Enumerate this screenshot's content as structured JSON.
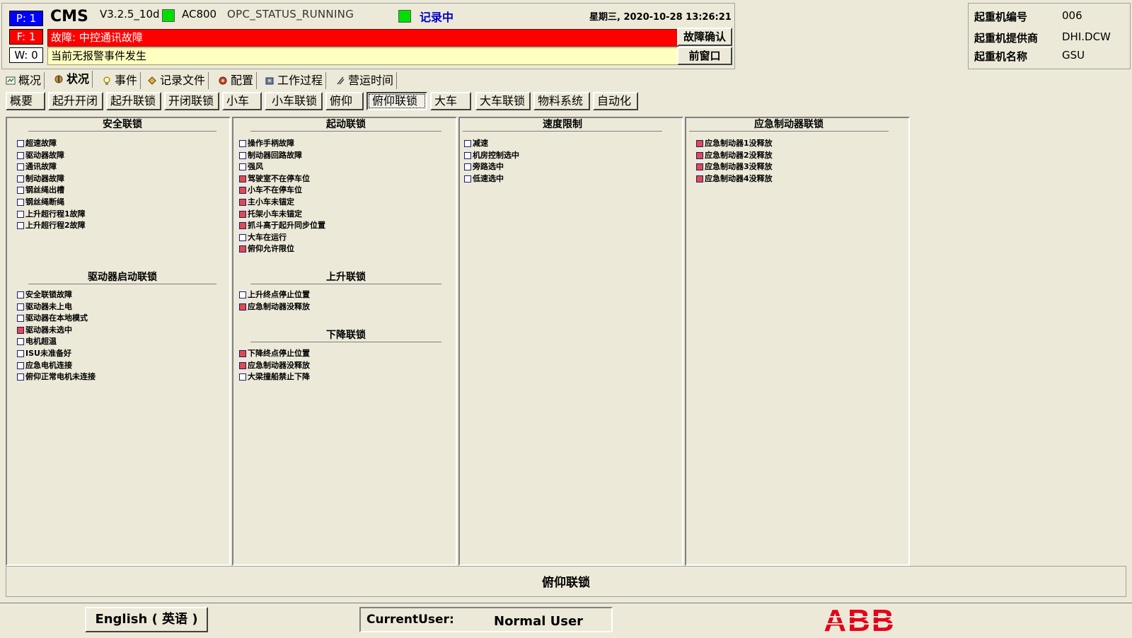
{
  "header": {
    "p_indicator": "P: 1",
    "f_indicator": "F: 1",
    "w_indicator": "W: 0",
    "app_name": "CMS",
    "version": "V3.2.5_10d",
    "controller": "AC800",
    "opc_status": "OPC_STATUS_RUNNING",
    "recording": "记录中",
    "datetime": "星期三, 2020-10-28  13:26:21",
    "fault_text": "故障: 中控通讯故障",
    "warning_text": "当前无报警事件发生",
    "ack_button": "故障确认",
    "front_button": "前窗口",
    "status_color": "#00e000"
  },
  "crane_info": {
    "number_label": "起重机编号",
    "number_value": "006",
    "supplier_label": "起重机提供商",
    "supplier_value": "DHI.DCW",
    "name_label": "起重机名称",
    "name_value": "GSU"
  },
  "main_tabs": [
    {
      "label": "概况",
      "icon": "overview-icon"
    },
    {
      "label": "状况",
      "icon": "status-icon"
    },
    {
      "label": "事件",
      "icon": "event-bulb-icon"
    },
    {
      "label": "记录文件",
      "icon": "record-file-icon"
    },
    {
      "label": "配置",
      "icon": "config-icon"
    },
    {
      "label": "工作过程",
      "icon": "work-process-icon"
    },
    {
      "label": "营运时间",
      "icon": "operation-time-icon"
    }
  ],
  "sub_tabs": [
    "概要",
    "起升开闭",
    "起升联锁",
    "开闭联锁",
    "小车",
    "小车联锁",
    "俯仰",
    "俯仰联锁",
    "大车",
    "大车联锁",
    "物料系统",
    "自动化"
  ],
  "active_sub_tab": "俯仰联锁",
  "sections": {
    "safety": {
      "title": "安全联锁",
      "items": [
        {
          "label": "超速故障",
          "on": false
        },
        {
          "label": "驱动器故障",
          "on": false
        },
        {
          "label": "通讯故障",
          "on": false
        },
        {
          "label": "制动器故障",
          "on": false
        },
        {
          "label": "钢丝绳出槽",
          "on": false
        },
        {
          "label": "钢丝绳断绳",
          "on": false
        },
        {
          "label": "上升超行程1故障",
          "on": false
        },
        {
          "label": "上升超行程2故障",
          "on": false
        }
      ]
    },
    "drive_start": {
      "title": "驱动器启动联锁",
      "items": [
        {
          "label": "安全联锁故障",
          "on": false
        },
        {
          "label": "驱动器未上电",
          "on": false
        },
        {
          "label": "驱动器在本地模式",
          "on": false
        },
        {
          "label": "驱动器未选中",
          "on": true
        },
        {
          "label": "电机超温",
          "on": false
        },
        {
          "label": "ISU未准备好",
          "on": false
        },
        {
          "label": "应急电机连接",
          "on": false
        },
        {
          "label": "俯仰正常电机未连接",
          "on": false
        }
      ]
    },
    "start": {
      "title": "起动联锁",
      "items": [
        {
          "label": "操作手柄故障",
          "on": false
        },
        {
          "label": "制动器回路故障",
          "on": false
        },
        {
          "label": "强风",
          "on": false
        },
        {
          "label": "驾驶室不在停车位",
          "on": true
        },
        {
          "label": "小车不在停车位",
          "on": true
        },
        {
          "label": "主小车未锚定",
          "on": true
        },
        {
          "label": "托架小车未锚定",
          "on": true
        },
        {
          "label": "抓斗高于起升同步位置",
          "on": true
        },
        {
          "label": "大车在运行",
          "on": false
        },
        {
          "label": "俯仰允许限位",
          "on": true
        }
      ]
    },
    "raise": {
      "title": "上升联锁",
      "items": [
        {
          "label": "上升终点停止位置",
          "on": false
        },
        {
          "label": "应急制动器没释放",
          "on": true
        }
      ]
    },
    "lower": {
      "title": "下降联锁",
      "items": [
        {
          "label": "下降终点停止位置",
          "on": true
        },
        {
          "label": "应急制动器没释放",
          "on": true
        },
        {
          "label": "大梁撞船禁止下降",
          "on": false
        }
      ]
    },
    "speed": {
      "title": "速度限制",
      "items": [
        {
          "label": "减速",
          "on": false
        },
        {
          "label": "机房控制选中",
          "on": false
        },
        {
          "label": "旁路选中",
          "on": false
        },
        {
          "label": "低速选中",
          "on": false
        }
      ]
    },
    "emergency_brake": {
      "title": "应急制动器联锁",
      "items": [
        {
          "label": "应急制动器1没释放",
          "on": true
        },
        {
          "label": "应急制动器2没释放",
          "on": true
        },
        {
          "label": "应急制动器3没释放",
          "on": true
        },
        {
          "label": "应急制动器4没释放",
          "on": true
        }
      ]
    }
  },
  "status_text": "俯仰联锁",
  "footer": {
    "language_button": "English ( 英语 )",
    "current_user_label": "CurrentUser:",
    "current_user_value": "Normal User",
    "logo_text": "ABB",
    "logo_color": "#e4001b"
  },
  "colors": {
    "on_box": "#e34a4a",
    "fault_bar": "#ff0000",
    "warning_bar": "#ffffc0",
    "p_indicator": "#0000ff"
  }
}
